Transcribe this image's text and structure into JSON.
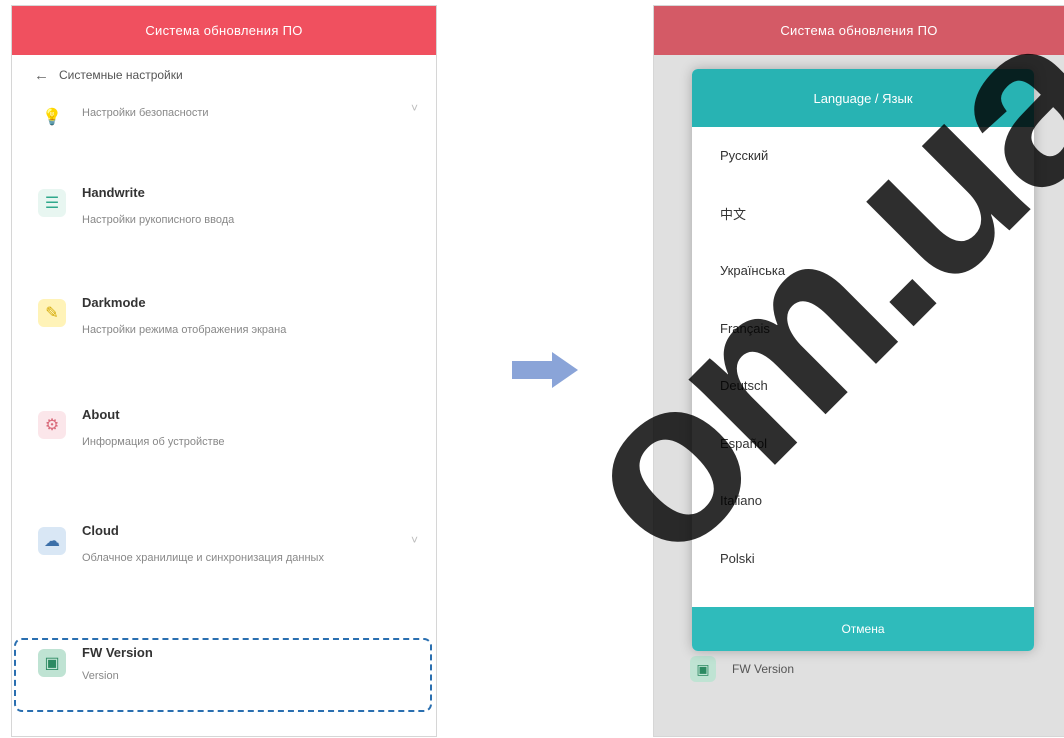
{
  "left": {
    "title": "Система обновления ПО",
    "subheader": "Системные настройки",
    "rows": [
      {
        "title": "",
        "subtitle": "Настройки безопасности"
      },
      {
        "title": "Handwrite",
        "subtitle": "Настройки рукописного ввода"
      },
      {
        "title": "Darkmode",
        "subtitle": "Настройки режима отображения экрана"
      },
      {
        "title": "About",
        "subtitle": "Информация об устройстве"
      },
      {
        "title": "Cloud",
        "subtitle": "Облачное хранилище и синхронизация данных"
      },
      {
        "title": "FW Version",
        "subtitle": "Version"
      }
    ]
  },
  "right": {
    "title": "Система обновления ПО",
    "dialog_title": "Language / Язык",
    "languages": [
      "Русский",
      "中文",
      "Українська",
      "Français",
      "Deutsch",
      "Español",
      "Italiano",
      "Polski"
    ],
    "footer": "Отмена",
    "peek_label": "FW Version"
  },
  "watermark": "om.ua",
  "icons": {
    "back": "arrow-left-icon",
    "security": "lightbulb-icon",
    "handwriting": "sliders-icon",
    "darkmode": "pencil-icon",
    "about": "gear-icon",
    "cloud": "cloud-icon",
    "fw": "chip-icon",
    "transition": "right-arrow-icon"
  },
  "colors": {
    "topbar": "#f0505f",
    "dialog_header": "#28b3b3",
    "highlight": "#2a6fb0",
    "arrow": "#8aa4d8"
  }
}
